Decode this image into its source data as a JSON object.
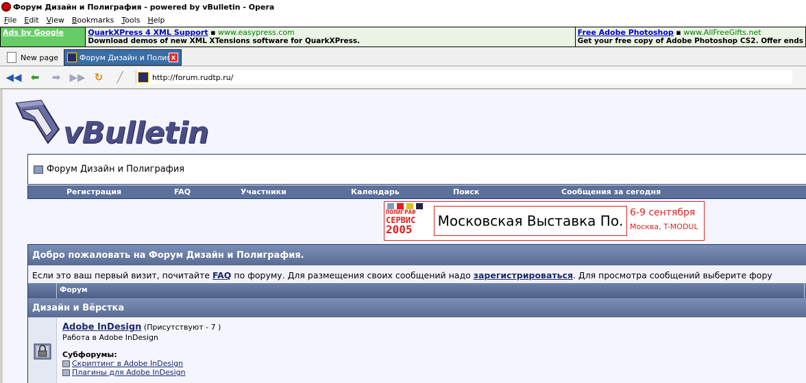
{
  "window": {
    "title": "Форум Дизайн и Полиграфия - powered by vBulletin - Opera"
  },
  "menu": [
    "File",
    "Edit",
    "View",
    "Bookmarks",
    "Tools",
    "Help"
  ],
  "ads": {
    "label": "Ads by Google",
    "items": [
      {
        "title": "QuarkXPress 4 XML Support",
        "url": "www.easypress.com",
        "desc": "Download demos of new XML XTensions software for QuarkXPress."
      },
      {
        "title": "Free Adobe Photoshop",
        "url": "www.AllFreeGifts.net",
        "desc": "Get your free copy of Adobe Photoshop CS2. Offer ends"
      }
    ]
  },
  "tabs": {
    "new_page": "New page",
    "active": "Форум Дизайн и Полигр...",
    "close": "x"
  },
  "address": {
    "url": "http://forum.rudtp.ru/"
  },
  "forum": {
    "logo_text": "vBulletin",
    "title": "Форум Дизайн и Полиграфия",
    "nav": [
      "Регистрация",
      "FAQ",
      "Участники",
      "Календарь",
      "Поиск",
      "Сообщения за сегодня"
    ]
  },
  "banner": {
    "left_top": "ПОЛИГРАФ",
    "left_mid": "СЕРВИС",
    "left_year": "2005",
    "middle": "Московская Выставка По.",
    "dates": "6-9 сентября",
    "place": "Москва, T-MODUL",
    "colors": [
      "#8899bb",
      "#e02020",
      "#e0c020",
      "#222244"
    ]
  },
  "welcome": {
    "heading": "Добро пожаловать на Форум Дизайн и Полиграфия.",
    "text_1": "Если это ваш первый визит, почитайте ",
    "faq_link": "FAQ",
    "text_2": " по форуму. Для размещения своих сообщений надо ",
    "register_link": "зарегистрироваться",
    "text_3": ". Для просмотра сообщений выберите фору"
  },
  "table": {
    "column_forum": "Форум",
    "category": "Дизайн и Вёрстка",
    "forum_name": "Adobe InDesign",
    "present": "(Присутствуют - 7 )",
    "description": "Работа в Adobe InDesign",
    "subforums_label": "Субфорумы:",
    "subforums": [
      "Скриптинг в Adobe InDesign",
      "Плагины для Adobe InDesign"
    ]
  }
}
